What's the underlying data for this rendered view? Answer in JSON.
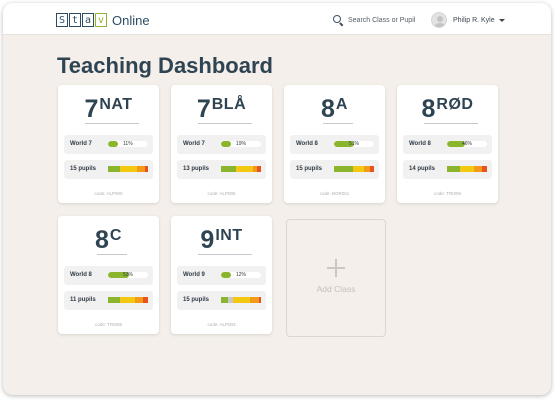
{
  "brand": {
    "logo_letters": [
      "S",
      "t",
      "a",
      "v"
    ],
    "logo_text": "Online",
    "logo_color": "#2d4d66",
    "logo_accent": "#8bb52c"
  },
  "search": {
    "placeholder": "Search Class or Pupil",
    "icon": "search-icon"
  },
  "user": {
    "name": "Philip R. Kyle",
    "avatar_icon": "avatar-icon",
    "menu_icon": "chevron-down-icon"
  },
  "page": {
    "title": "Teaching Dashboard"
  },
  "colors": {
    "progress": "#8bb52c",
    "dist_green": "#8bb52c",
    "dist_yellow": "#f2c811",
    "dist_orange": "#f39a18",
    "dist_red": "#e8541d",
    "dist_gray": "#c8c8c8"
  },
  "classes": [
    {
      "number": "7",
      "suffix": "NAT",
      "level": "World 7",
      "progress": 11,
      "progress_label": "11%",
      "pupils_label": "15 pupils",
      "distribution": [
        30,
        0,
        42,
        20,
        8
      ],
      "code": "code: ALP000"
    },
    {
      "number": "7",
      "suffix": "BLÅ",
      "level": "World 7",
      "progress": 19,
      "progress_label": "19%",
      "pupils_label": "13 pupils",
      "distribution": [
        37,
        0,
        43,
        10,
        10
      ],
      "code": "code: ALP005"
    },
    {
      "number": "8",
      "suffix": "A",
      "level": "World 8",
      "progress": 51,
      "progress_label": "51%",
      "pupils_label": "15 pupils",
      "distribution": [
        47,
        0,
        28,
        14,
        11
      ],
      "code": "code: BOR051"
    },
    {
      "number": "8",
      "suffix": "RØD",
      "level": "World 8",
      "progress": 46,
      "progress_label": "46%",
      "pupils_label": "14 pupils",
      "distribution": [
        33,
        0,
        35,
        20,
        12
      ],
      "code": "code: TRI006"
    },
    {
      "number": "8",
      "suffix": "C",
      "level": "World 8",
      "progress": 53,
      "progress_label": "53%",
      "pupils_label": "11 pupils",
      "distribution": [
        30,
        0,
        37,
        20,
        13
      ],
      "code": "code: TRI006"
    },
    {
      "number": "9",
      "suffix": "INT",
      "level": "World 9",
      "progress": 12,
      "progress_label": "12%",
      "pupils_label": "15 pupils",
      "distribution": [
        17,
        14,
        41,
        23,
        5
      ],
      "code": "code: ALP003"
    }
  ],
  "add_class": {
    "label": "Add Class",
    "icon": "plus-icon"
  }
}
